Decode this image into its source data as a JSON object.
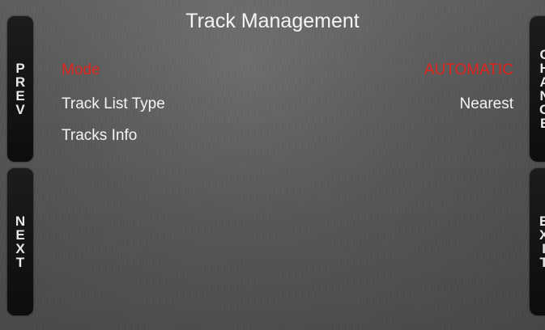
{
  "screen": {
    "title": "Track Management"
  },
  "buttons": {
    "prev": [
      "P",
      "R",
      "E",
      "V"
    ],
    "next": [
      "N",
      "E",
      "X",
      "T"
    ],
    "change": [
      "C",
      "H",
      "A",
      "N",
      "G",
      "E"
    ],
    "exit": [
      "E",
      "X",
      "I",
      "T"
    ]
  },
  "settings": {
    "mode": {
      "label": "Mode",
      "value": "AUTOMATIC"
    },
    "track_list_type": {
      "label": "Track List Type",
      "value": "Nearest"
    },
    "tracks_info": {
      "label": "Tracks Info"
    }
  },
  "colors": {
    "selected_text": "#e0231c",
    "normal_text": "#f4f4f4",
    "button_background": "#141414",
    "screen_background": "#585858"
  }
}
